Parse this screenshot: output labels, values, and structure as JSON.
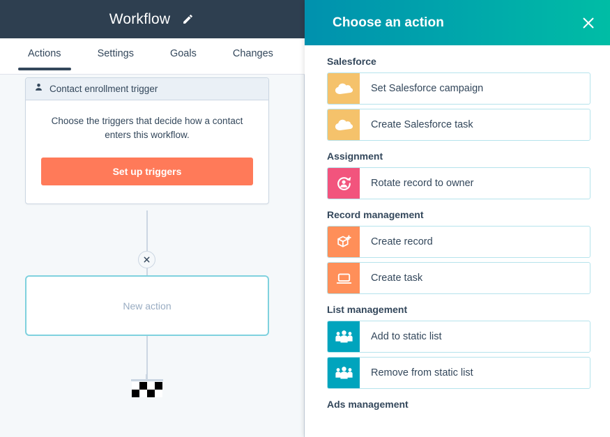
{
  "editor": {
    "title": "Workflow",
    "edit_icon": "pencil-icon",
    "tabs": [
      {
        "label": "Actions",
        "active": true
      },
      {
        "label": "Settings",
        "active": false
      },
      {
        "label": "Goals",
        "active": false
      },
      {
        "label": "Changes",
        "active": false
      }
    ],
    "trigger_card": {
      "icon": "contact-person-icon",
      "header": "Contact enrollment trigger",
      "description": "Choose the triggers that decide how a contact enters this workflow.",
      "button": "Set up triggers"
    },
    "remove_node_icon": "close-x-icon",
    "new_action_label": "New action",
    "goal_flag_icon": "checkered-flag-icon"
  },
  "panel": {
    "title": "Choose an action",
    "close_icon": "close-x-icon",
    "sections": [
      {
        "title": "Salesforce",
        "items": [
          {
            "label": "Set Salesforce campaign",
            "icon": "cloud-icon",
            "color": "#f5c26b"
          },
          {
            "label": "Create Salesforce task",
            "icon": "cloud-icon",
            "color": "#f5c26b"
          }
        ]
      },
      {
        "title": "Assignment",
        "items": [
          {
            "label": "Rotate record to owner",
            "icon": "rotate-owner-icon",
            "color": "#f2547d"
          }
        ]
      },
      {
        "title": "Record management",
        "items": [
          {
            "label": "Create record",
            "icon": "create-record-icon",
            "color": "#ff8f59"
          },
          {
            "label": "Create task",
            "icon": "create-task-icon",
            "color": "#ff8f59"
          }
        ]
      },
      {
        "title": "List management",
        "items": [
          {
            "label": "Add to static list",
            "icon": "people-group-icon",
            "color": "#00a4bd"
          },
          {
            "label": "Remove from static list",
            "icon": "people-group-icon",
            "color": "#00a4bd"
          }
        ]
      },
      {
        "title": "Ads management",
        "items": []
      }
    ]
  },
  "colors": {
    "topbar": "#2e3f50",
    "cta_orange": "#ff7a59",
    "panel_gradient_start": "#0091ae",
    "panel_gradient_end": "#00bda5",
    "new_action_border": "#7fd1de",
    "card_border": "#b5e3ec",
    "canvas_bg": "#f5f8fa"
  }
}
